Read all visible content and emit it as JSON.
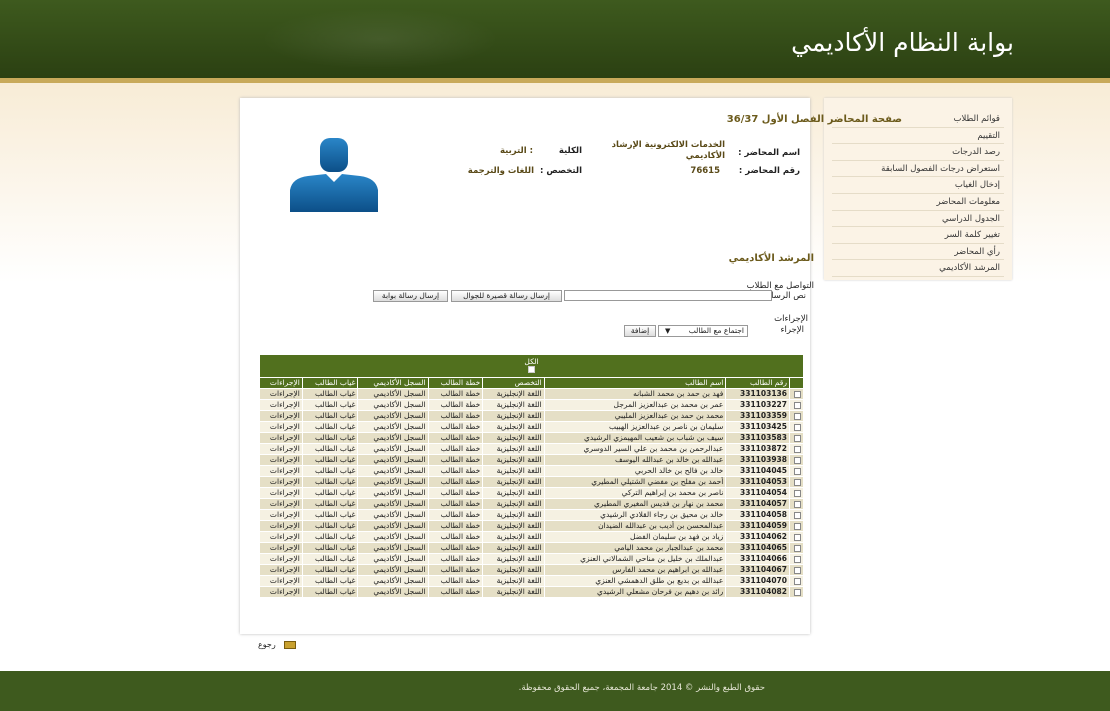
{
  "site_title": "بوابة النظام الأكاديمي",
  "sidebar": {
    "items": [
      "قوائم الطلاب",
      "التقييم",
      "رصد الدرجات",
      "استعراض درجات الفصول السابقة",
      "إدخال الغياب",
      "معلومات المحاضر",
      "الجدول الدراسي",
      "تغيير كلمة السر",
      "رأي المحاضر",
      "المرشد الأكاديمي"
    ]
  },
  "page_title": "صفحة المحاضر  الفصل الأول 36/37",
  "lecturer": {
    "name_label": "اسم المحاضر :",
    "name_value": "الخدمات الالكترونية الإرشاد الأكاديمي",
    "college_label": "الكلية",
    "college_value": ": التربية",
    "id_label": "رقم المحاضر :",
    "id_value": "76615",
    "major_label": "التخصص :",
    "major_value": "اللغات والترجمة"
  },
  "advisor_title": "المرشد الأكاديمي",
  "contact": {
    "title": "التواصل مع الطلاب",
    "msg_label": "نص الرسالة",
    "sms_button": "إرسال رسالة قصيرة للجوال",
    "portal_button": "إرسال رسالة بوابة"
  },
  "actions": {
    "title": "الإجراءات",
    "action_label": "الإجراء",
    "selected": "اجتماع مع الطالب",
    "add_button": "إضافة"
  },
  "table": {
    "all_label": "الكل",
    "headers": [
      "رقم الطالب",
      "اسم الطالب",
      "التخصص",
      "خطة الطالب",
      "السجل الأكاديمي",
      "غياب الطالب",
      "الإجراءات"
    ],
    "rows": [
      [
        "331103136",
        "فهد بن حمد بن محمد الشبانه",
        "اللغة الإنجليزية",
        "خطة الطالب",
        "السجل الأكاديمي",
        "غياب الطالب",
        "الإجراءات"
      ],
      [
        "331103227",
        "عمر بن محمد بن عبدالعزيز المرجل",
        "اللغة الإنجليزية",
        "خطة الطالب",
        "السجل الأكاديمي",
        "غياب الطالب",
        "الإجراءات"
      ],
      [
        "331103359",
        "محمد بن حمد بن عبدالعزيز المليبي",
        "اللغة الإنجليزية",
        "خطة الطالب",
        "السجل الأكاديمي",
        "غياب الطالب",
        "الإجراءات"
      ],
      [
        "331103425",
        "سليمان بن ناصر بن عبدالعزيز الهبيب",
        "اللغة الإنجليزية",
        "خطة الطالب",
        "السجل الأكاديمي",
        "غياب الطالب",
        "الإجراءات"
      ],
      [
        "331103583",
        "سيف بن شباب بن شعيب المهيمزي الرشيدي",
        "اللغة الإنجليزية",
        "خطة الطالب",
        "السجل الأكاديمي",
        "غياب الطالب",
        "الإجراءات"
      ],
      [
        "331103872",
        "عبدالرحمن بن محمد بن علي السير الدوسري",
        "اللغة الإنجليزية",
        "خطة الطالب",
        "السجل الأكاديمي",
        "غياب الطالب",
        "الإجراءات"
      ],
      [
        "331103938",
        "عبدالله بن خالد بن عبدالله اليوسف",
        "اللغة الإنجليزية",
        "خطة الطالب",
        "السجل الأكاديمي",
        "غياب الطالب",
        "الإجراءات"
      ],
      [
        "331104045",
        "خالد بن فالح بن خالد الحربي",
        "اللغة الإنجليزية",
        "خطة الطالب",
        "السجل الأكاديمي",
        "غياب الطالب",
        "الإجراءات"
      ],
      [
        "331104053",
        "أحمد بن مفلح بن مفضي الشتيلي المطيري",
        "اللغة الإنجليزية",
        "خطة الطالب",
        "السجل الأكاديمي",
        "غياب الطالب",
        "الإجراءات"
      ],
      [
        "331104054",
        "ناصر بن محمد بن إبراهيم التركي",
        "اللغة الإنجليزية",
        "خطة الطالب",
        "السجل الأكاديمي",
        "غياب الطالب",
        "الإجراءات"
      ],
      [
        "331104057",
        "محمد بن نهار بن فديس المغيري المطيري",
        "اللغة الإنجليزية",
        "خطة الطالب",
        "السجل الأكاديمي",
        "غياب الطالب",
        "الإجراءات"
      ],
      [
        "331104058",
        "خالد بن محيق بن رجاء القلادي الرشيدي",
        "اللغة الإنجليزية",
        "خطة الطالب",
        "السجل الأكاديمي",
        "غياب الطالب",
        "الإجراءات"
      ],
      [
        "331104059",
        "عبدالمحسن بن أديب بن عبدالله الضيدان",
        "اللغة الإنجليزية",
        "خطة الطالب",
        "السجل الأكاديمي",
        "غياب الطالب",
        "الإجراءات"
      ],
      [
        "331104062",
        "زياد بن فهد بن سليمان الفضل",
        "اللغة الإنجليزية",
        "خطة الطالب",
        "السجل الأكاديمي",
        "غياب الطالب",
        "الإجراءات"
      ],
      [
        "331104065",
        "محمد بن عبدالجبار بن محمد اليامي",
        "اللغة الإنجليزية",
        "خطة الطالب",
        "السجل الأكاديمي",
        "غياب الطالب",
        "الإجراءات"
      ],
      [
        "331104066",
        "عبدالملك بن خليل بن مناحي الشمالاني العنزي",
        "اللغة الإنجليزية",
        "خطة الطالب",
        "السجل الأكاديمي",
        "غياب الطالب",
        "الإجراءات"
      ],
      [
        "331104067",
        "عبدالله بن ابراهيم بن محمد الفارس",
        "اللغة الإنجليزية",
        "خطة الطالب",
        "السجل الأكاديمي",
        "غياب الطالب",
        "الإجراءات"
      ],
      [
        "331104070",
        "عبدالله بن بديع بن طلق الدهمشي العنزي",
        "اللغة الإنجليزية",
        "خطة الطالب",
        "السجل الأكاديمي",
        "غياب الطالب",
        "الإجراءات"
      ],
      [
        "331104082",
        "رائد بن دهيم بن فرحان مشعلي الرشيدي",
        "اللغة الإنجليزية",
        "خطة الطالب",
        "السجل الأكاديمي",
        "غياب الطالب",
        "الإجراءات"
      ]
    ]
  },
  "back_label": "رجوع",
  "footer": "حقوق الطبع والنشر © 2014 جامعة المجمعة، جميع الحقوق محفوظة."
}
